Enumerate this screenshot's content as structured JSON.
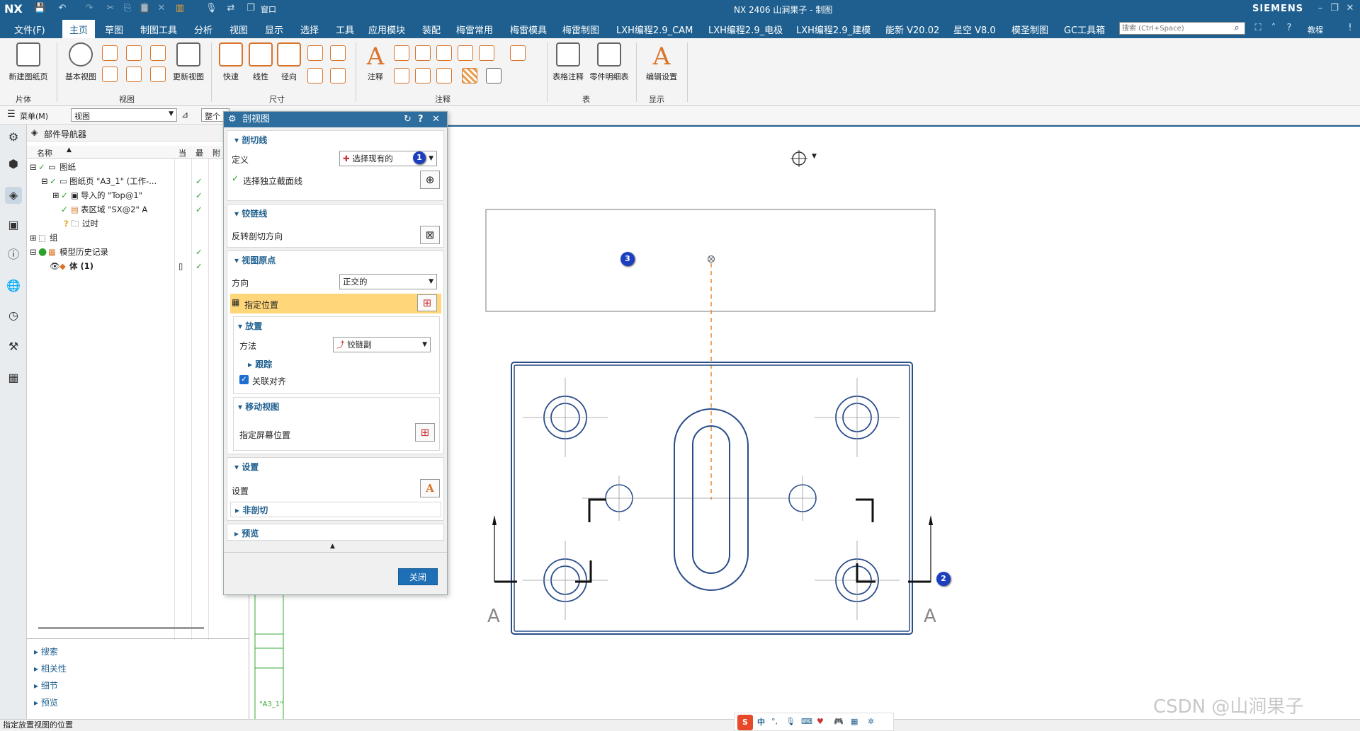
{
  "app": {
    "logo": "NX",
    "title": "NX 2406 山涧果子 - 制图",
    "brand": "SIEMENS",
    "window_menu": "窗口",
    "help_label": "教程",
    "search_placeholder": "搜索 (Ctrl+Space)"
  },
  "menu": {
    "file": "文件(F)",
    "tabs": [
      "主页",
      "草图",
      "制图工具",
      "分析",
      "视图",
      "显示",
      "选择",
      "工具",
      "应用模块",
      "装配",
      "梅雷常用",
      "梅雷模具",
      "梅雷制图",
      "LXH编程2.9_CAM",
      "LXH编程2.9_电极",
      "LXH编程2.9_建模",
      "能新 V20.02",
      "星空 V8.0",
      "模圣制图",
      "GC工具箱"
    ],
    "active_tab": "主页"
  },
  "ribbon": {
    "new_sheet": "新建图纸页",
    "base_view": "基本视图",
    "update_view": "更新视图",
    "quick": "快速",
    "linear": "线性",
    "radial": "径向",
    "note": "注释",
    "table_note": "表格注释",
    "parts_list": "零件明细表",
    "edit_settings": "编辑设置",
    "groups": {
      "sheet": "片体",
      "view": "视图",
      "dimension": "尺寸",
      "annotation": "注释",
      "table": "表",
      "display": "显示"
    }
  },
  "toolbar2": {
    "menu_label": "菜单(M)",
    "filter_value": "视图",
    "scope_value": "整个"
  },
  "navigator": {
    "title": "部件导航器",
    "col_name": "名称",
    "col_current": "当",
    "col_latest": "最",
    "col_attach": "附",
    "rows": [
      "图纸",
      "图纸页 \"A3_1\" (工作-...",
      "导入的 \"Top@1\"",
      "表区域 \"SX@2\" A",
      "过时",
      "组",
      "模型历史记录",
      "体 (1)"
    ],
    "bottom_panels": [
      "搜索",
      "相关性",
      "细节",
      "预览"
    ]
  },
  "dialog": {
    "title": "剖视图",
    "sec_cutline": "剖切线",
    "define_label": "定义",
    "define_value": "选择现有的",
    "select_cutline": "选择独立截面线",
    "sec_hinge": "铰链线",
    "reverse_dir": "反转剖切方向",
    "sec_origin": "视图原点",
    "direction_label": "方向",
    "direction_value": "正交的",
    "specify_location": "指定位置",
    "sec_placement": "放置",
    "method_label": "方法",
    "method_value": "铰链副",
    "track": "跟踪",
    "assoc_align": "关联对齐",
    "assoc_align_checked": true,
    "sec_move_view": "移动视图",
    "specify_screen_pos": "指定屏幕位置",
    "sec_settings": "设置",
    "settings_label": "设置",
    "non_section": "非剖切",
    "sec_preview": "预览",
    "close_button": "关闭"
  },
  "canvas": {
    "section_label_left": "A",
    "section_label_right": "A",
    "sheet_tab": "\"A3_1\"",
    "callouts": [
      "1",
      "2",
      "3"
    ]
  },
  "status": {
    "message": "指定放置视图的位置",
    "ime_label": "中",
    "watermark": "CSDN @山涧果子"
  },
  "colors": {
    "title_bg": "#1e5f8f",
    "dialog_title_bg": "#2d6e9f",
    "highlight_row": "#ffd77a",
    "drawing_line": "#2a4d8a",
    "section_line": "#e8882a",
    "callout": "#1c3fbf"
  }
}
